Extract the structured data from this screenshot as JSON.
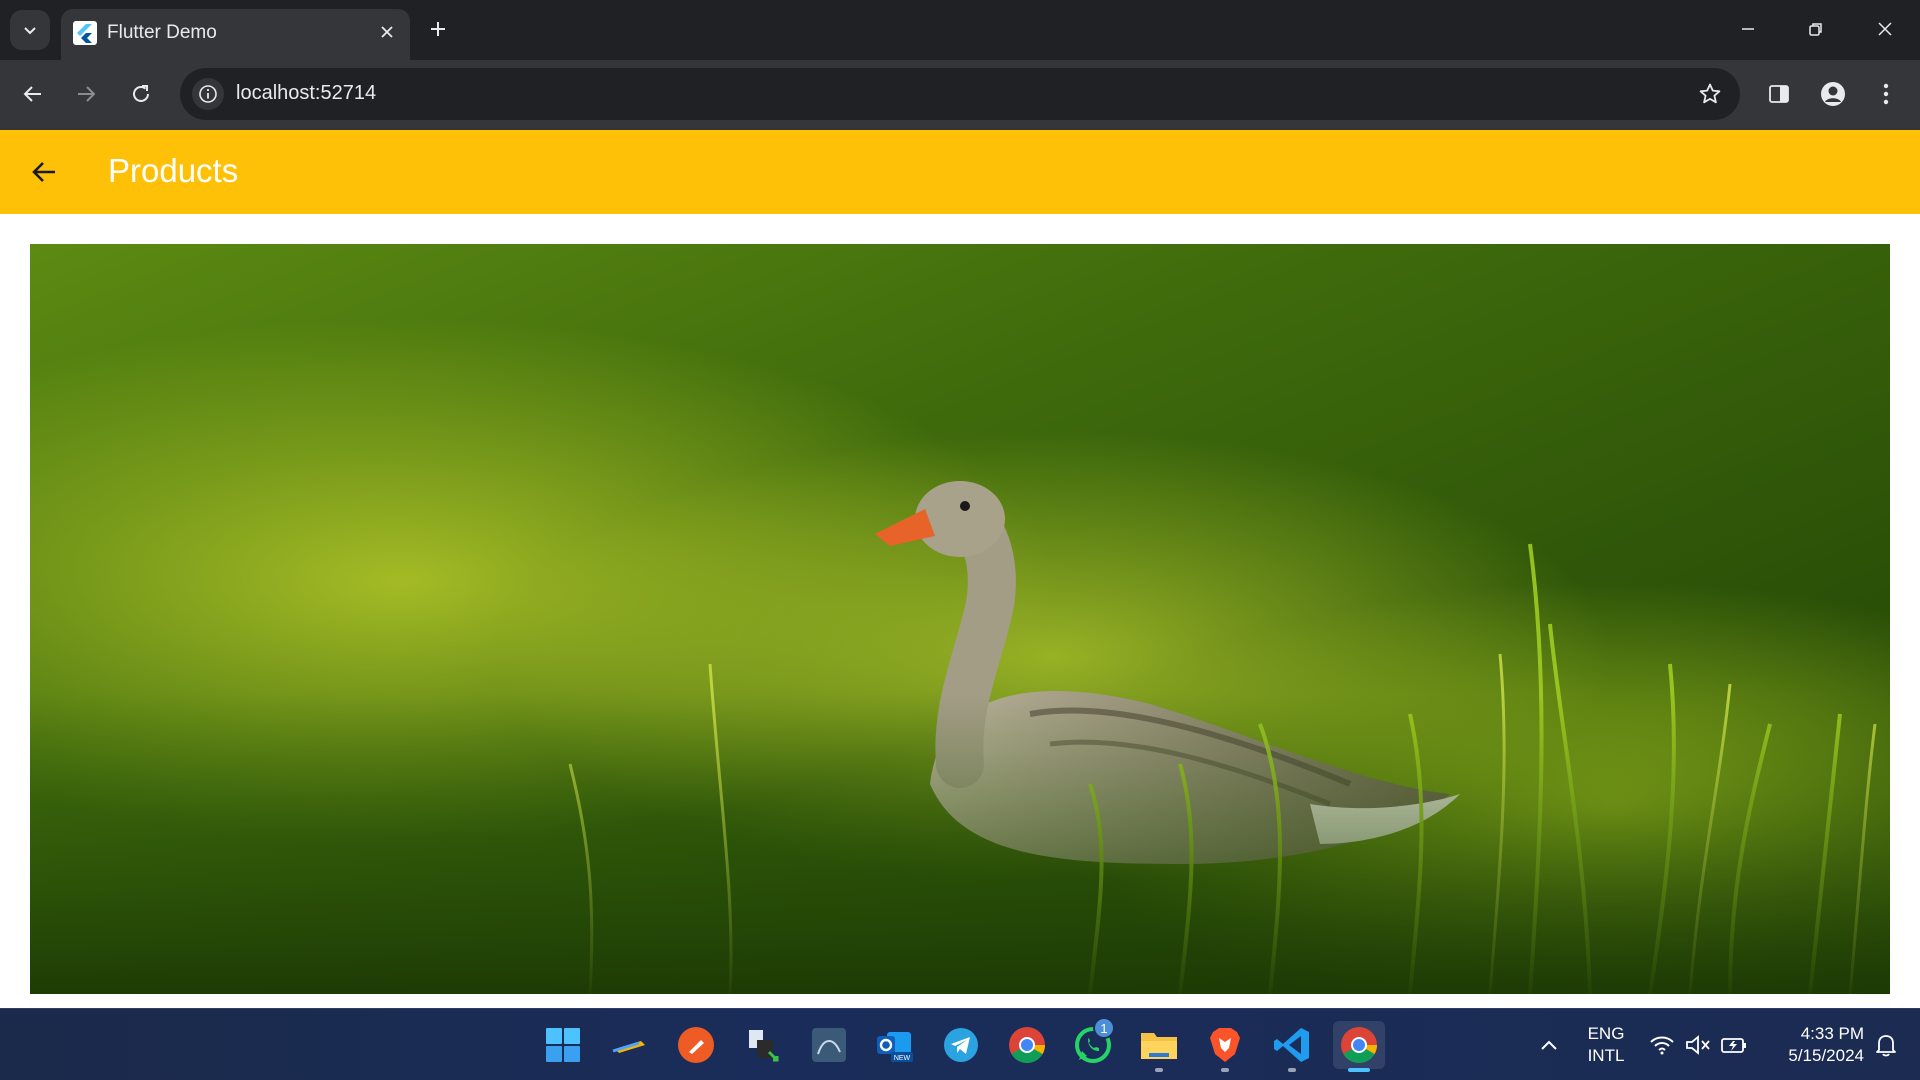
{
  "browser": {
    "tab_title": "Flutter Demo",
    "url": "localhost:52714"
  },
  "app": {
    "title": "Products",
    "accent_color": "#ffc107",
    "image_subject": "greylag goose standing in tall green grass"
  },
  "taskbar": {
    "apps": [
      {
        "name": "start-icon"
      },
      {
        "name": "ruler-app-icon"
      },
      {
        "name": "postman-icon"
      },
      {
        "name": "transfer-app-icon"
      },
      {
        "name": "mysql-workbench-icon"
      },
      {
        "name": "outlook-new-icon"
      },
      {
        "name": "telegram-icon"
      },
      {
        "name": "chrome-icon"
      },
      {
        "name": "whatsapp-icon",
        "badge": "1"
      },
      {
        "name": "file-explorer-icon"
      },
      {
        "name": "brave-icon"
      },
      {
        "name": "vscode-icon"
      },
      {
        "name": "chrome-active-icon"
      }
    ],
    "language_line1": "ENG",
    "language_line2": "INTL",
    "time": "4:33 PM",
    "date": "5/15/2024"
  }
}
